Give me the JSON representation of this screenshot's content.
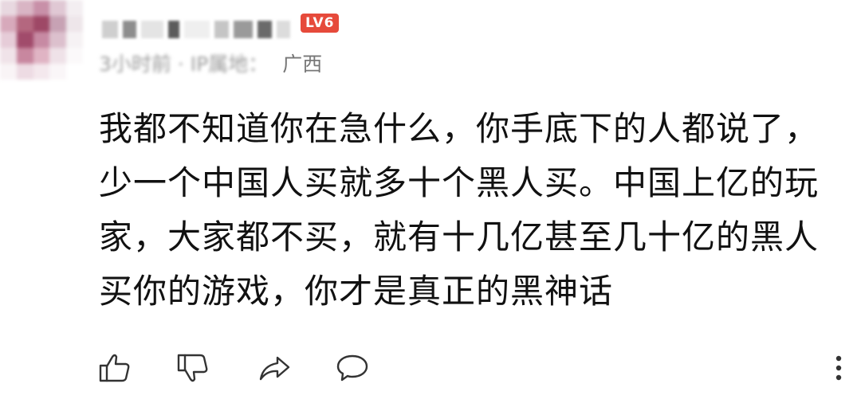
{
  "user": {
    "avatar": "pixelated-avatar",
    "username_obscured": true,
    "level_badge": "LV6",
    "badge_color": "#e64a3b"
  },
  "meta": {
    "time_obscured": "3小时前 · IP属地：",
    "location": "广西"
  },
  "comment": {
    "text": "我都不知道你在急什么，你手底下的人都说了，少一个中国人买就多十个黑人买。中国上亿的玩家，大家都不买，就有十几亿甚至几十亿的黑人买你的游戏，你才是真正的黑神话"
  },
  "actions": {
    "like_icon": "thumbs-up-icon",
    "dislike_icon": "thumbs-down-icon",
    "share_icon": "share-arrow-icon",
    "reply_icon": "comment-bubble-icon",
    "more_icon": "more-vertical-icon"
  }
}
